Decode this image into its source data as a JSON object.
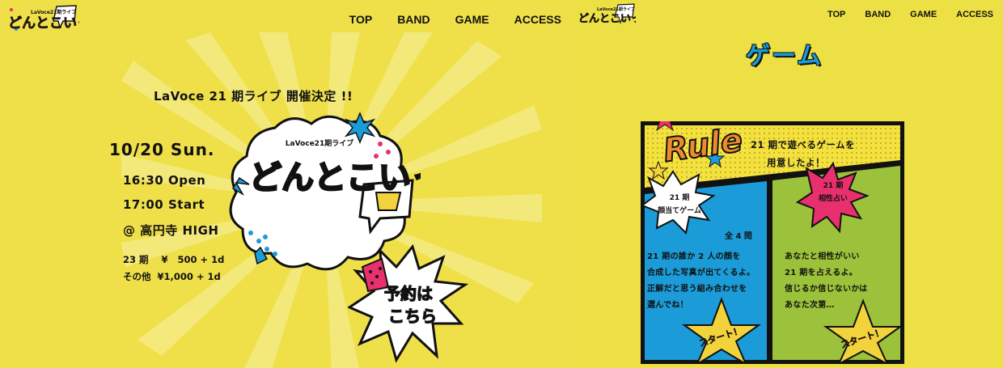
{
  "left": {
    "logo": {
      "main": "どんとこいっ",
      "sub": "LaVoce21期ライブ"
    },
    "nav": [
      "TOP",
      "BAND",
      "GAME",
      "ACCESS"
    ],
    "announcement": "LaVoce  21 期ライブ   開催決定 !!",
    "date": "10/20  Sun.",
    "open": "16:30  Open",
    "start": "17:00  Start",
    "venue": "@ 高円寺 HIGH",
    "price_21": "23 期    ¥   500 + 1d",
    "price_other": "その他  ¥1,000 + 1d",
    "art": {
      "subtitle": "LaVoce21期ライブ",
      "title": "どんとこいっ"
    },
    "reserve_label_1": "予約は",
    "reserve_label_2": "こちら"
  },
  "right": {
    "logo": {
      "main": "どんとこいっ",
      "sub": "LaVoce21期ライブ"
    },
    "nav": [
      "TOP",
      "BAND",
      "GAME",
      "ACCESS"
    ],
    "title": "ゲーム",
    "rule_word": "Rule",
    "rule_line_1": "21 期で遊べるゲームを",
    "rule_line_2": "用意したよ！",
    "game1": {
      "badge_line_1": "21 期",
      "badge_line_2": "顔当てゲーム",
      "count": "全 4 問",
      "desc": [
        "21 期の誰か 2 人の顔を",
        "合成した写真が出てくるよ。",
        "正解だと思う組み合わせを",
        "選んでね！"
      ],
      "start": "スタート！"
    },
    "game2": {
      "badge_line_1": "21 期",
      "badge_line_2": "相性占い",
      "desc": [
        "あなたと相性がいい",
        "21 期を占えるよ。",
        "信じるか信じないかは",
        "あなた次第…"
      ],
      "start": "スタート！"
    }
  },
  "colors": {
    "background": "#EFE04A",
    "blue": "#1B9BD7",
    "green": "#9BC23A",
    "pink": "#E8306E",
    "orange": "#F08A2E",
    "black": "#111111"
  }
}
